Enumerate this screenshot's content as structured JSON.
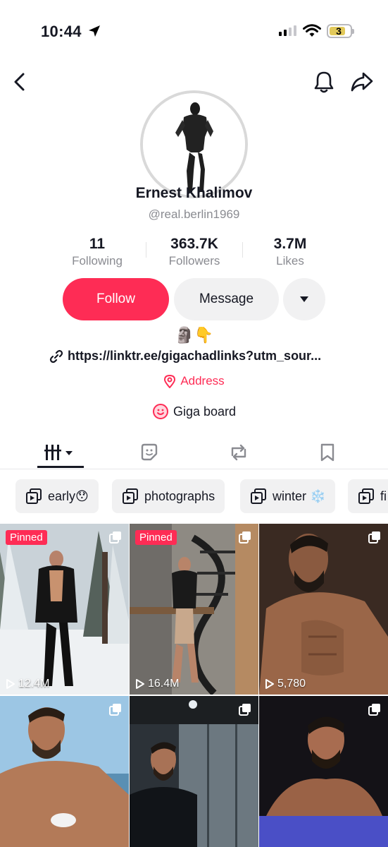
{
  "status_bar": {
    "time": "10:44",
    "battery": "3"
  },
  "profile": {
    "name": "Ernest Khalimov",
    "handle": "@real.berlin1969",
    "stats": [
      {
        "value": "11",
        "label": "Following"
      },
      {
        "value": "363.7K",
        "label": "Followers"
      },
      {
        "value": "3.7M",
        "label": "Likes"
      }
    ],
    "follow_label": "Follow",
    "message_label": "Message",
    "bio_emojis": "🗿👇",
    "link": "https://linktr.ee/gigachadlinks?utm_sour...",
    "address_label": "Address",
    "board_label": "Giga board"
  },
  "tabs": [
    {
      "icon": "videos-grid-icon",
      "active": true
    },
    {
      "icon": "favorites-icon",
      "active": false
    },
    {
      "icon": "repost-icon",
      "active": false
    },
    {
      "icon": "bookmark-icon",
      "active": false
    }
  ],
  "playlists": [
    {
      "label": "early😯"
    },
    {
      "label": "photographs"
    },
    {
      "label": "winter ❄️"
    },
    {
      "label": "fi"
    }
  ],
  "posts": [
    {
      "pinned_label": "Pinned",
      "views": "12.4M",
      "scene": "snow"
    },
    {
      "pinned_label": "Pinned",
      "views": "16.4M",
      "scene": "stairs"
    },
    {
      "pinned_label": "",
      "views": "5,780",
      "scene": "studio"
    },
    {
      "pinned_label": "",
      "views": "",
      "scene": "beach"
    },
    {
      "pinned_label": "",
      "views": "",
      "scene": "elevator"
    },
    {
      "pinned_label": "",
      "views": "",
      "scene": "pool"
    }
  ],
  "colors": {
    "accent": "#fe2c55",
    "text": "#161823",
    "muted": "#8a8b91",
    "chip_bg": "#f1f1f2"
  }
}
